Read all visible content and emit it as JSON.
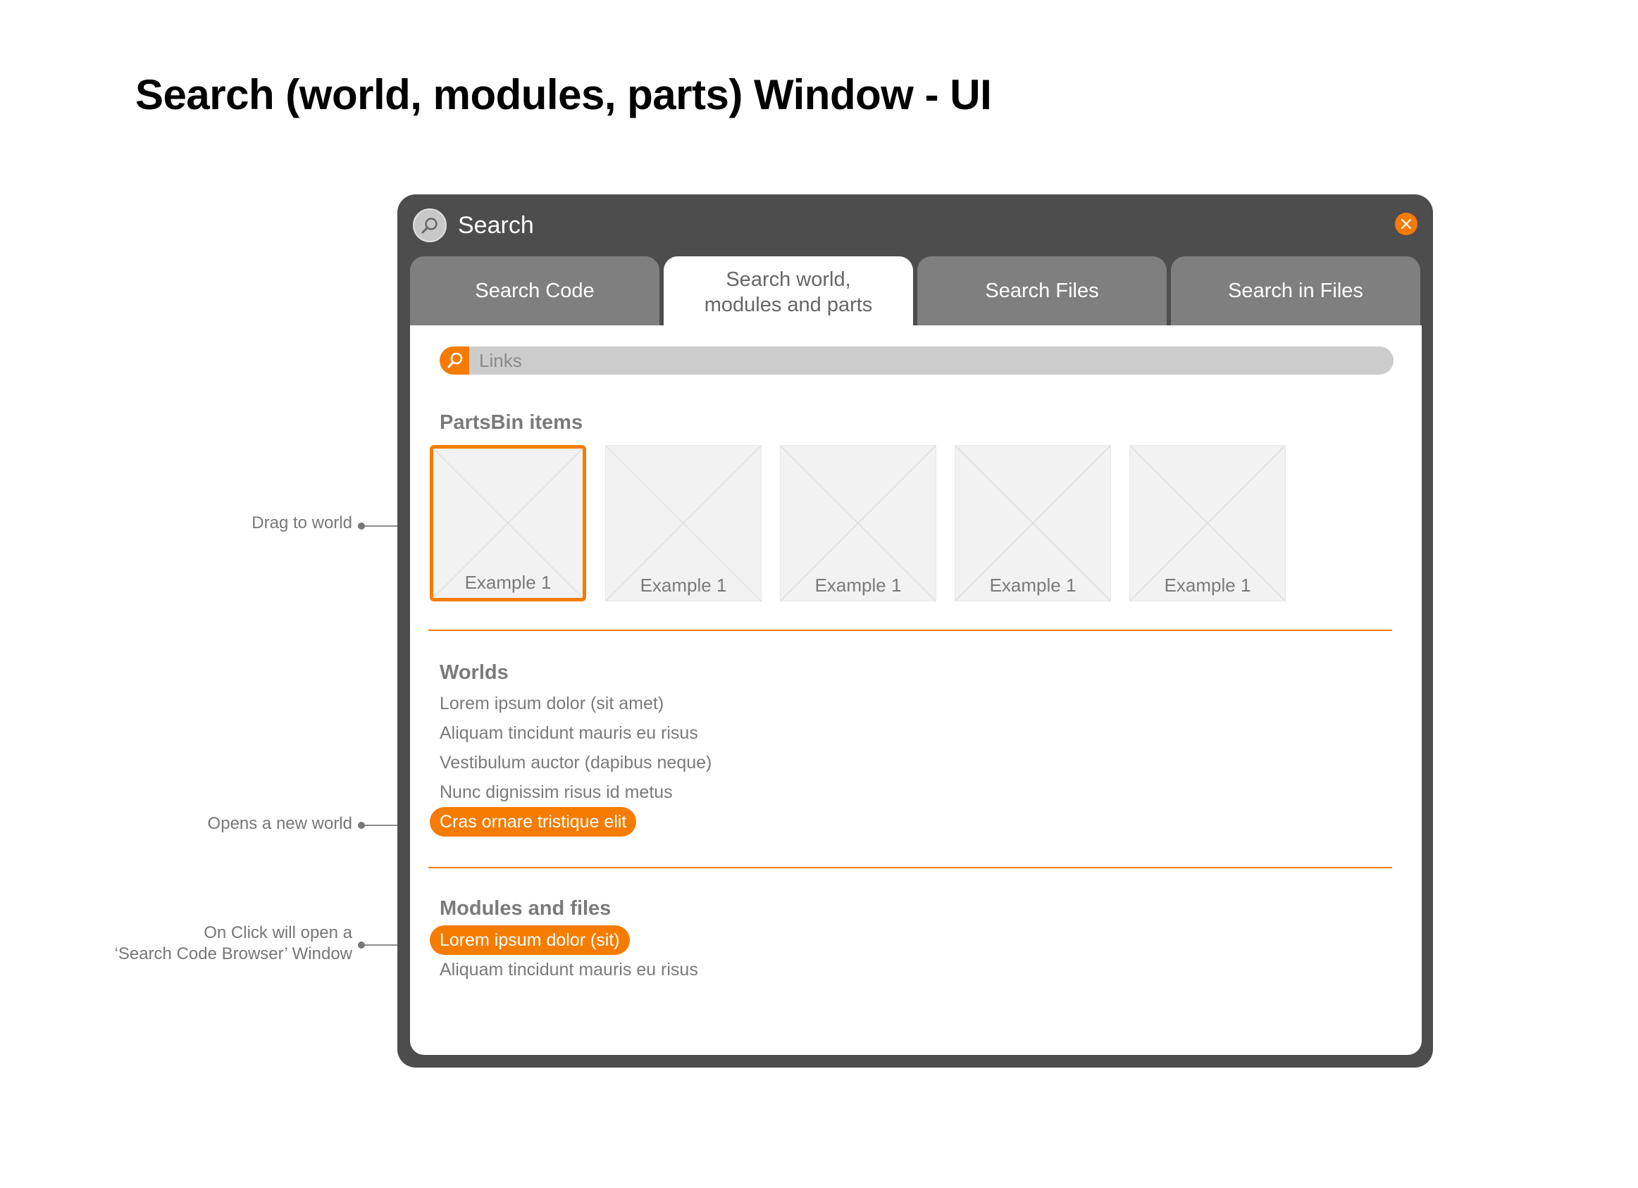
{
  "page": {
    "title": "Search (world, modules, parts) Window - UI"
  },
  "annotations": {
    "drag": "Drag to world",
    "opens_world": "Opens a new world",
    "on_click_line1": "On Click will open a",
    "on_click_line2": "‘Search Code Browser’ Window"
  },
  "window": {
    "title": "Search",
    "icon": "search-icon",
    "close_icon": "close-icon",
    "tabs": [
      {
        "label": "Search Code",
        "active": false
      },
      {
        "label": "Search world,\nmodules and parts",
        "active": true
      },
      {
        "label": "Search Files",
        "active": false
      },
      {
        "label": "Search in Files",
        "active": false
      }
    ],
    "search": {
      "placeholder": "Links",
      "value": ""
    }
  },
  "sections": {
    "parts": {
      "heading": "PartsBin items",
      "items": [
        {
          "label": "Example 1",
          "selected": true
        },
        {
          "label": "Example 1",
          "selected": false
        },
        {
          "label": "Example 1",
          "selected": false
        },
        {
          "label": "Example 1",
          "selected": false
        },
        {
          "label": "Example 1",
          "selected": false
        }
      ]
    },
    "worlds": {
      "heading": "Worlds",
      "items": [
        {
          "label": "Lorem ipsum dolor (sit amet)",
          "highlighted": false
        },
        {
          "label": "Aliquam tincidunt mauris eu risus",
          "highlighted": false
        },
        {
          "label": "Vestibulum auctor (dapibus neque)",
          "highlighted": false
        },
        {
          "label": "Nunc dignissim risus id metus",
          "highlighted": false
        },
        {
          "label": "Cras ornare tristique elit",
          "highlighted": true
        }
      ]
    },
    "modules": {
      "heading": "Modules and files",
      "items": [
        {
          "label": "Lorem ipsum dolor (sit)",
          "highlighted": true
        },
        {
          "label": "Aliquam tincidunt mauris eu risus",
          "highlighted": false
        }
      ]
    }
  },
  "colors": {
    "accent": "#f57c00",
    "window_frame": "#4d4d4d",
    "tab_inactive": "#7f7f7f",
    "text_muted": "#7a7a7a"
  }
}
